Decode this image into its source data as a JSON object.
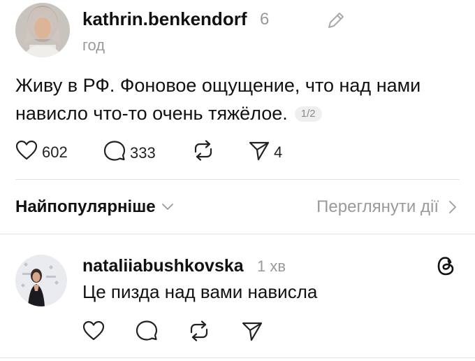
{
  "post": {
    "username": "kathrin.benkendorf",
    "time_top": "6",
    "time_bottom": "год",
    "text": "Живу в РФ. Фоновое ощущение, что над нами нависло что-то очень тяжёлое.",
    "page_indicator": "1/2",
    "likes": "602",
    "comments": "333",
    "shares": "4"
  },
  "sort_bar": {
    "sort_label": "Найпопулярніше",
    "view_activity_label": "Переглянути дії"
  },
  "reply": {
    "username": "nataliiabushkovska",
    "time": "1 хв",
    "text": "Це пизда над вами нависла"
  },
  "icons": {
    "edit": "pencil-icon",
    "like": "heart-icon",
    "comment": "comment-icon",
    "repost": "repost-icon",
    "share": "send-icon",
    "sort_chevron": "chevron-down-icon",
    "view_chevron": "chevron-right-icon",
    "app_logo": "threads-logo-icon"
  },
  "colors": {
    "text": "#111111",
    "muted": "#9a9a9a",
    "divider": "#e2e2e2",
    "badge_bg": "#efefef"
  }
}
